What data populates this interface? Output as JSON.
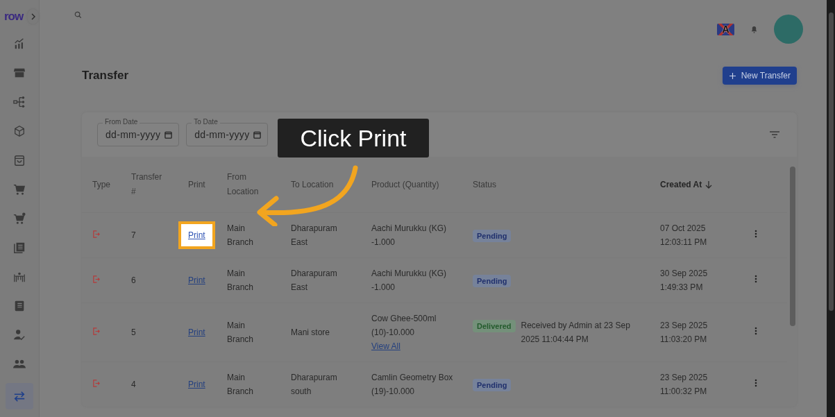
{
  "sidebar": {
    "logo": "row",
    "items": [
      {
        "kind": "chart",
        "selected": false
      },
      {
        "kind": "store",
        "selected": false
      },
      {
        "kind": "hierarchy",
        "selected": false
      },
      {
        "kind": "box",
        "selected": false
      },
      {
        "kind": "bag",
        "selected": false
      },
      {
        "kind": "cart",
        "selected": false
      },
      {
        "kind": "cart-plus",
        "selected": false
      },
      {
        "kind": "stack",
        "selected": false
      },
      {
        "kind": "table",
        "selected": false
      },
      {
        "kind": "book",
        "selected": false
      },
      {
        "kind": "user-check",
        "selected": false
      },
      {
        "kind": "users",
        "selected": false
      },
      {
        "kind": "transfer",
        "selected": true
      }
    ]
  },
  "header": {
    "language": "A"
  },
  "page": {
    "title": "Transfer",
    "new_button": "New Transfer"
  },
  "filters": [
    {
      "label": "From Date",
      "placeholder": "dd-mm-yyyy"
    },
    {
      "label": "To Date",
      "placeholder": "dd-mm-yyyy"
    }
  ],
  "table": {
    "columns": [
      {
        "label": "Type",
        "sorted": false
      },
      {
        "label": "Transfer #",
        "sorted": false
      },
      {
        "label": "Print",
        "sorted": false
      },
      {
        "label": "From Location",
        "sorted": false
      },
      {
        "label": "To Location",
        "sorted": false
      },
      {
        "label": "Product (Quantity)",
        "sorted": false
      },
      {
        "label": "Status",
        "sorted": false
      },
      {
        "label": "Created At",
        "sorted": true
      }
    ],
    "rows": [
      {
        "number": "7",
        "print": "Print",
        "highlighted": true,
        "from": "Main Branch",
        "to": "Dharapuram East",
        "product": "Aachi Murukku (KG) -1.000",
        "status": {
          "kind": "pending",
          "label": "Pending"
        },
        "created": [
          "07 Oct 2025",
          "12:03:11 PM"
        ]
      },
      {
        "number": "6",
        "print": "Print",
        "highlighted": false,
        "from": "Main Branch",
        "to": "Dharapuram East",
        "product": "Aachi Murukku (KG) -1.000",
        "status": {
          "kind": "pending",
          "label": "Pending"
        },
        "created": [
          "30 Sep 2025",
          "1:49:33 PM"
        ]
      },
      {
        "number": "5",
        "print": "Print",
        "highlighted": false,
        "from": "Main Branch",
        "to": "Mani store",
        "product": "Cow Ghee-500ml (10)-10.000",
        "view_all": "View All",
        "status": {
          "kind": "delivered",
          "label": "Delivered",
          "note": "Received by Admin at 23 Sep 2025 11:04:44 PM"
        },
        "created": [
          "23 Sep 2025",
          "11:03:20 PM"
        ]
      },
      {
        "number": "4",
        "print": "Print",
        "highlighted": false,
        "from": "Main Branch",
        "to": "Dharapuram south",
        "product": "Camlin Geometry Box (19)-10.000",
        "status": {
          "kind": "pending",
          "label": "Pending"
        },
        "created": [
          "23 Sep 2025",
          "11:00:32 PM"
        ]
      }
    ]
  },
  "tooltip": {
    "text": "Click Print"
  }
}
